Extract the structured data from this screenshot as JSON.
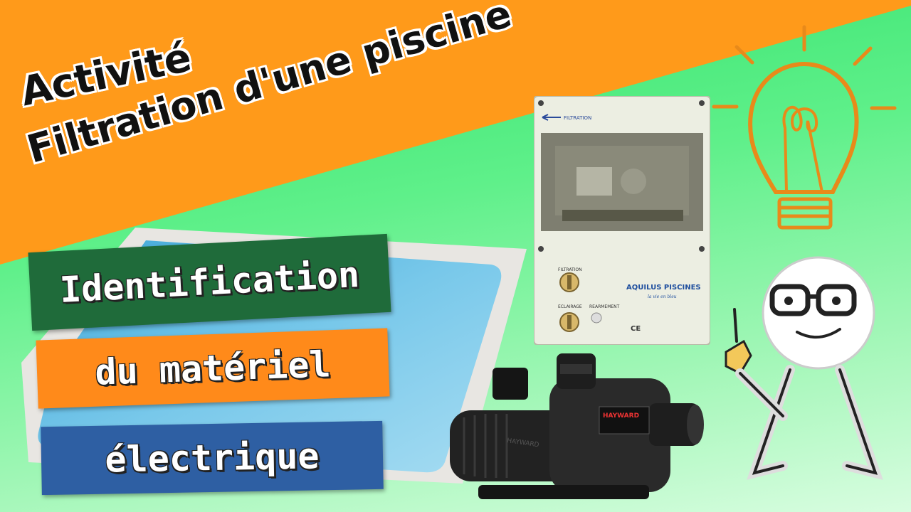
{
  "title": {
    "line1": "Activité",
    "line2": "Filtration d'une piscine"
  },
  "labels": {
    "line1": "Identification",
    "line2": "du matériel",
    "line3": "électrique"
  },
  "cabinet": {
    "filtration_tag": "FILTRATION",
    "brand": "AQUILUS PISCINES",
    "tagline": "la vie en bleu",
    "knob1_label": "FILTRATION",
    "knob2_label": "ECLAIRAGE",
    "knob3_label": "REARMEMENT",
    "ce_mark": "CE"
  },
  "pump": {
    "brand": "HAYWARD",
    "side_brand": "HAYWARD"
  },
  "colors": {
    "orange": "#ff9a1a",
    "green_label": "#1f6b3a",
    "orange_label": "#ff8a1a",
    "blue_label": "#2e5fa3",
    "bulb": "#e88a1a"
  },
  "icons": {
    "bulb": "lightbulb-icon",
    "person": "stick-figure-with-glasses"
  }
}
